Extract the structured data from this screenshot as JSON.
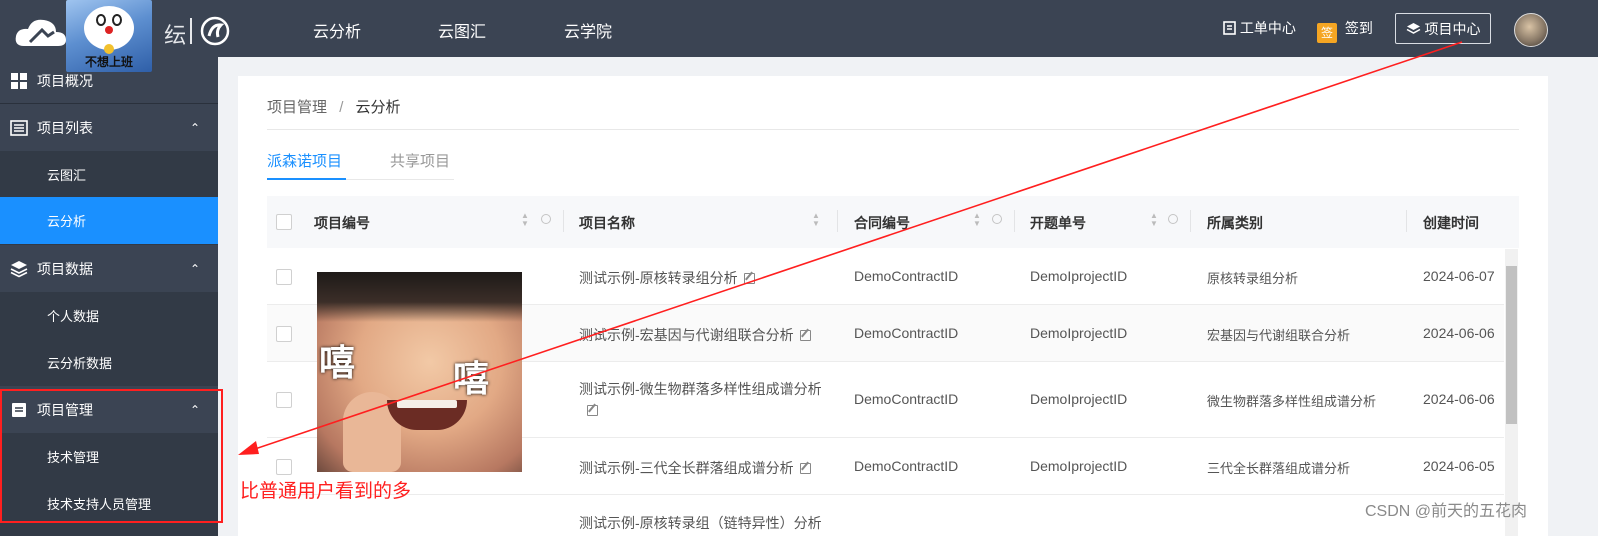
{
  "header": {
    "brand_suffix": "纭",
    "nav": [
      "云分析",
      "云图汇",
      "云学院"
    ],
    "ticket_label": "工单中心",
    "signin_badge": "签",
    "signin_label": "签到",
    "project_center_label": "项目中心",
    "sticker_caption": "不想上班"
  },
  "sidebar": {
    "overview": "项目概况",
    "project_list": "项目列表",
    "list_sub": [
      "云图汇",
      "云分析"
    ],
    "project_data": "项目数据",
    "data_sub": [
      "个人数据",
      "云分析数据"
    ],
    "project_manage": "项目管理",
    "manage_sub": [
      "技术管理",
      "技术支持人员管理"
    ]
  },
  "content": {
    "breadcrumb_root": "项目管理",
    "breadcrumb_sep": "/",
    "breadcrumb_current": "云分析",
    "tabs": [
      "派森诺项目",
      "共享项目"
    ],
    "columns": [
      "项目编号",
      "项目名称",
      "合同编号",
      "开题单号",
      "所属类别",
      "创建时间"
    ],
    "rows": [
      {
        "name": "测试示例-原核转录组分析",
        "contract": "DemoContractID",
        "topic": "DemoIprojectID",
        "category": "原核转录组分析",
        "date": "2024-06-07"
      },
      {
        "name": "测试示例-宏基因与代谢组联合分析",
        "contract": "DemoContractID",
        "topic": "DemoIprojectID",
        "category": "宏基因与代谢组联合分析",
        "date": "2024-06-06"
      },
      {
        "name": "测试示例-微生物群落多样性组成谱分析",
        "contract": "DemoContractID",
        "topic": "DemoIprojectID",
        "category": "微生物群落多样性组成谱分析",
        "date": "2024-06-06"
      },
      {
        "name": "测试示例-三代全长群落组成谱分析",
        "contract": "DemoContractID",
        "topic": "DemoIprojectID",
        "category": "三代全长群落组成谱分析",
        "date": "2024-06-05"
      },
      {
        "name": "测试示例-原核转录组（链特异性）分析",
        "contract": "",
        "topic": "",
        "category": "",
        "date": ""
      }
    ]
  },
  "overlay": {
    "baby_text_left": "嘻",
    "baby_text_right": "嘻",
    "annotation": "比普通用户看到的多",
    "watermark": "CSDN @前天的五花肉"
  },
  "colors": {
    "accent": "#1a90ff",
    "topbar": "#3b4453",
    "sidebar": "#323a46",
    "annotation": "#ff1f1f"
  }
}
